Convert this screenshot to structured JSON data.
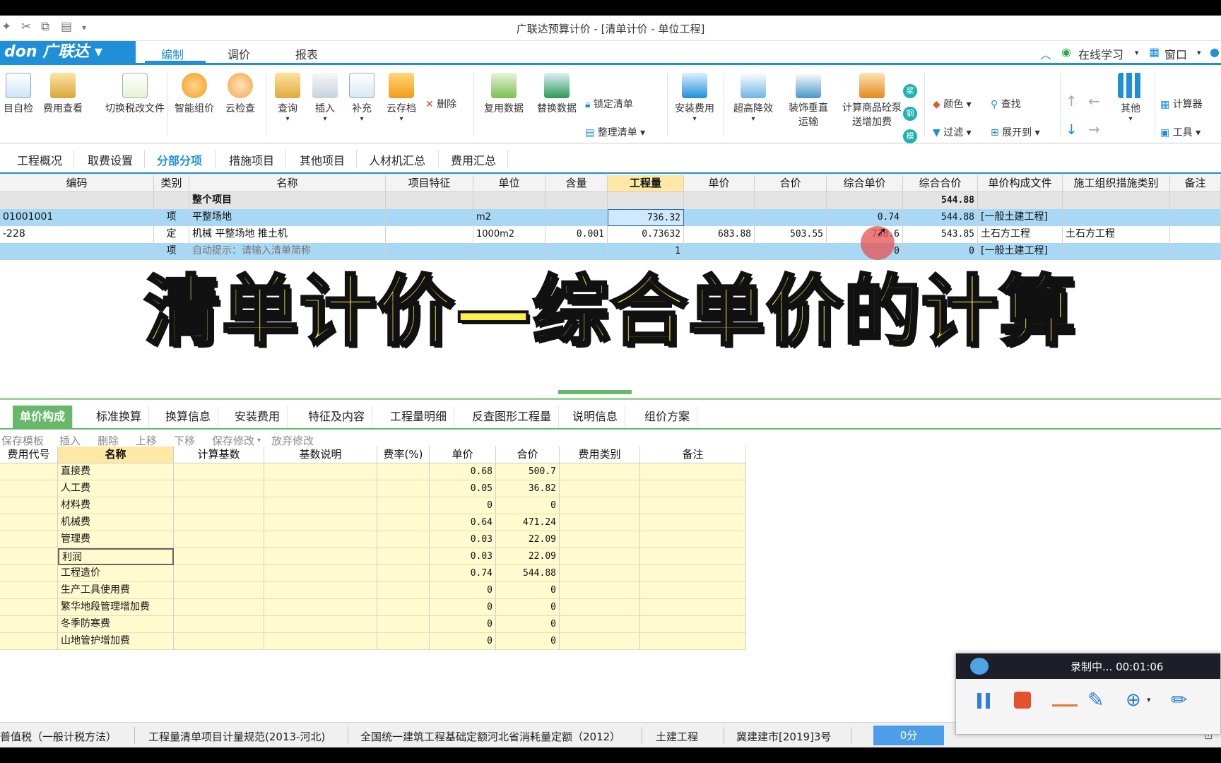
{
  "window": {
    "title": "广联达预算计价 - [清单计价 - 单位工程]"
  },
  "menubar": {
    "logo": "don 广联达",
    "tabs": [
      "编制",
      "调价",
      "报表"
    ],
    "active_tab": "编制",
    "online_learning": "在线学习",
    "window_menu": "窗口"
  },
  "ribbon": {
    "buttons": [
      {
        "label": "目自检",
        "icon": "check-icon"
      },
      {
        "label": "费用查看",
        "icon": "fee-view-icon"
      },
      {
        "label": "切换税改文件",
        "icon": "tax-switch-icon"
      },
      {
        "label": "智能组价",
        "icon": "smart-price-icon"
      },
      {
        "label": "云检查",
        "icon": "cloud-check-icon"
      },
      {
        "label": "查询",
        "icon": "query-icon"
      },
      {
        "label": "插入",
        "icon": "insert-icon"
      },
      {
        "label": "补充",
        "icon": "supplement-icon"
      },
      {
        "label": "云存档",
        "icon": "cloud-archive-icon"
      },
      {
        "label": "删除",
        "icon": "delete-icon"
      },
      {
        "label": "复用数据",
        "icon": "reuse-data-icon"
      },
      {
        "label": "替换数据",
        "icon": "replace-data-icon"
      },
      {
        "label": "锁定清单",
        "icon": "lock-icon"
      },
      {
        "label": "整理清单",
        "icon": "organize-icon"
      },
      {
        "label": "安装费用",
        "icon": "install-fee-icon"
      },
      {
        "label": "超高降效",
        "icon": "height-icon"
      },
      {
        "label": "装饰垂直运输",
        "icon": "vertical-transport-icon"
      },
      {
        "label": "计算商品砼泵送增加费",
        "icon": "pump-icon"
      },
      {
        "label": "颜色",
        "icon": "color-icon"
      },
      {
        "label": "查找",
        "icon": "find-icon"
      },
      {
        "label": "过滤",
        "icon": "filter-icon"
      },
      {
        "label": "展开到",
        "icon": "expand-icon"
      },
      {
        "label": "其他",
        "icon": "other-icon"
      },
      {
        "label": "计算器",
        "icon": "calculator-icon"
      },
      {
        "label": "工具",
        "icon": "tools-icon"
      }
    ]
  },
  "view_tabs": [
    "工程概况",
    "取费设置",
    "分部分项",
    "措施项目",
    "其他项目",
    "人材机汇总",
    "费用汇总"
  ],
  "active_view_tab": "分部分项",
  "top_grid": {
    "headers": [
      "编码",
      "类别",
      "名称",
      "项目特征",
      "单位",
      "含量",
      "工程量",
      "单价",
      "合价",
      "综合单价",
      "综合合价",
      "单价构成文件",
      "施工组织措施类别",
      "备注"
    ],
    "rows": [
      {
        "code": "",
        "type": "",
        "name": "整个项目",
        "feature": "",
        "unit": "",
        "content": "",
        "qty": "",
        "price": "",
        "total": "",
        "unit_price": "",
        "comp_total": "544.88",
        "file": "",
        "measure": "",
        "note": ""
      },
      {
        "code": "01001001",
        "type": "项",
        "name": "平整场地",
        "feature": "",
        "unit": "m2",
        "content": "",
        "qty": "736.32",
        "price": "",
        "total": "",
        "unit_price": "0.74",
        "comp_total": "544.88",
        "file": "[一般土建工程]",
        "measure": "",
        "note": ""
      },
      {
        "code": "-228",
        "type": "定",
        "name": "机械 平整场地 推土机",
        "feature": "",
        "unit": "1000m2",
        "content": "0.001",
        "qty": "0.73632",
        "price": "683.88",
        "total": "503.55",
        "unit_price": "738.6",
        "comp_total": "543.85",
        "file": "土石方工程",
        "measure": "土石方工程",
        "note": ""
      },
      {
        "code": "",
        "type": "项",
        "name": "自动提示：请输入清单简称",
        "feature": "",
        "unit": "",
        "content": "",
        "qty": "1",
        "price": "",
        "total": "",
        "unit_price": "0",
        "comp_total": "0",
        "file": "[一般土建工程]",
        "measure": "",
        "note": ""
      }
    ]
  },
  "headline": "清单计价—综合单价的计算",
  "bottom_tabs": [
    "单价构成",
    "标准换算",
    "换算信息",
    "安装费用",
    "特征及内容",
    "工程量明细",
    "反查图形工程量",
    "说明信息",
    "组价方案"
  ],
  "active_bottom_tab": "单价构成",
  "bottom_toolbar": [
    "保存模板",
    "插入",
    "删除",
    "上移",
    "下移",
    "保存修改",
    "放弃修改"
  ],
  "cost_grid": {
    "headers": [
      "费用代号",
      "名称",
      "计算基数",
      "基数说明",
      "费率(%)",
      "单价",
      "合价",
      "费用类别",
      "备注"
    ],
    "rows": [
      {
        "name": "直接费",
        "unit": "0.68",
        "total": "500.7"
      },
      {
        "name": "人工费",
        "unit": "0.05",
        "total": "36.82"
      },
      {
        "name": "材料费",
        "unit": "0",
        "total": "0"
      },
      {
        "name": "机械费",
        "unit": "0.64",
        "total": "471.24"
      },
      {
        "name": "管理费",
        "unit": "0.03",
        "total": "22.09"
      },
      {
        "name": "利润",
        "unit": "0.03",
        "total": "22.09"
      },
      {
        "name": "工程造价",
        "unit": "0.74",
        "total": "544.88"
      },
      {
        "name": "生产工具使用费",
        "unit": "0",
        "total": "0"
      },
      {
        "name": "繁华地段管理增加费",
        "unit": "0",
        "total": "0"
      },
      {
        "name": "冬季防寒费",
        "unit": "0",
        "total": "0"
      },
      {
        "name": "山地管护增加费",
        "unit": "0",
        "total": "0"
      }
    ]
  },
  "status_bar": {
    "items": [
      "普值税（一般计税方法）",
      "工程量清单项目计量规范(2013-河北)",
      "全国统一建筑工程基础定额河北省消耗量定额（2012）",
      "土建工程",
      "冀建建市[2019]3号"
    ],
    "score": "0分"
  },
  "recorder": {
    "status": "录制中... 00:01:06"
  }
}
